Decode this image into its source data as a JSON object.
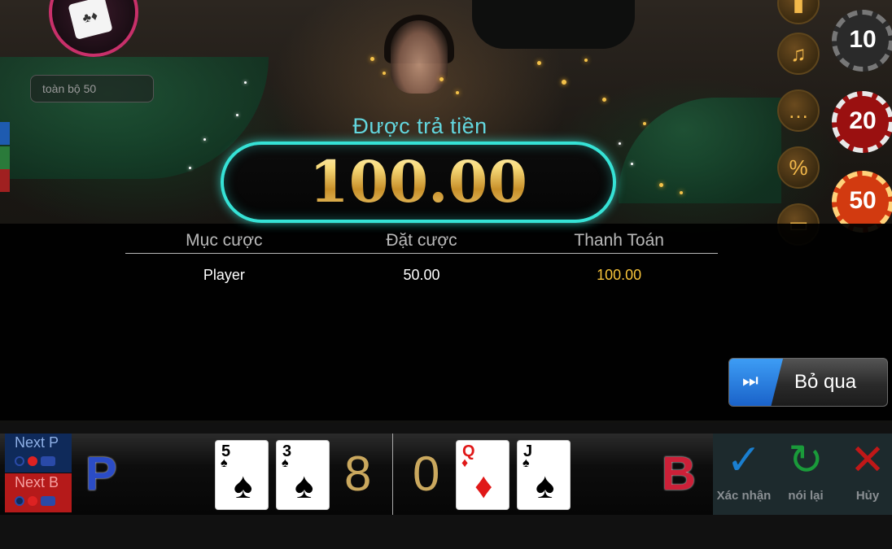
{
  "top_left": {
    "total_label": "toàn bộ  50",
    "avatar_icon": "cards-icon"
  },
  "side_menu": {
    "music_icon": "♫",
    "chat_icon": "…",
    "promo_icon": "%"
  },
  "chips": [
    "10",
    "20",
    "50"
  ],
  "payout": {
    "title": "Được trả tiền",
    "amount": "100.00"
  },
  "results_table": {
    "headers": [
      "Mục cược",
      "Đặt cược",
      "Thanh Toán"
    ],
    "rows": [
      {
        "bet_type": "Player",
        "bet": "50.00",
        "payout": "100.00"
      }
    ]
  },
  "skip_button": {
    "label": "Bỏ qua",
    "icon": "⏭"
  },
  "next_buttons": {
    "player": "Next P",
    "banker": "Next B"
  },
  "round": {
    "player_letter": "P",
    "banker_letter": "B",
    "player_score": "8",
    "banker_score": "0",
    "player_cards": [
      {
        "rank": "5",
        "suit": "♠",
        "color": "black"
      },
      {
        "rank": "3",
        "suit": "♠",
        "color": "black"
      }
    ],
    "banker_cards": [
      {
        "rank": "Q",
        "suit": "♦",
        "color": "red"
      },
      {
        "rank": "J",
        "suit": "♠",
        "color": "black"
      }
    ]
  },
  "actions": {
    "confirm": {
      "label": "Xác nhận",
      "glyph": "✓",
      "color": "#1a7fd0"
    },
    "redo": {
      "label": "nói lại",
      "glyph": "↻",
      "color": "#1a9a3a"
    },
    "cancel": {
      "label": "Hủy",
      "glyph": "✕",
      "color": "#c01818"
    }
  }
}
